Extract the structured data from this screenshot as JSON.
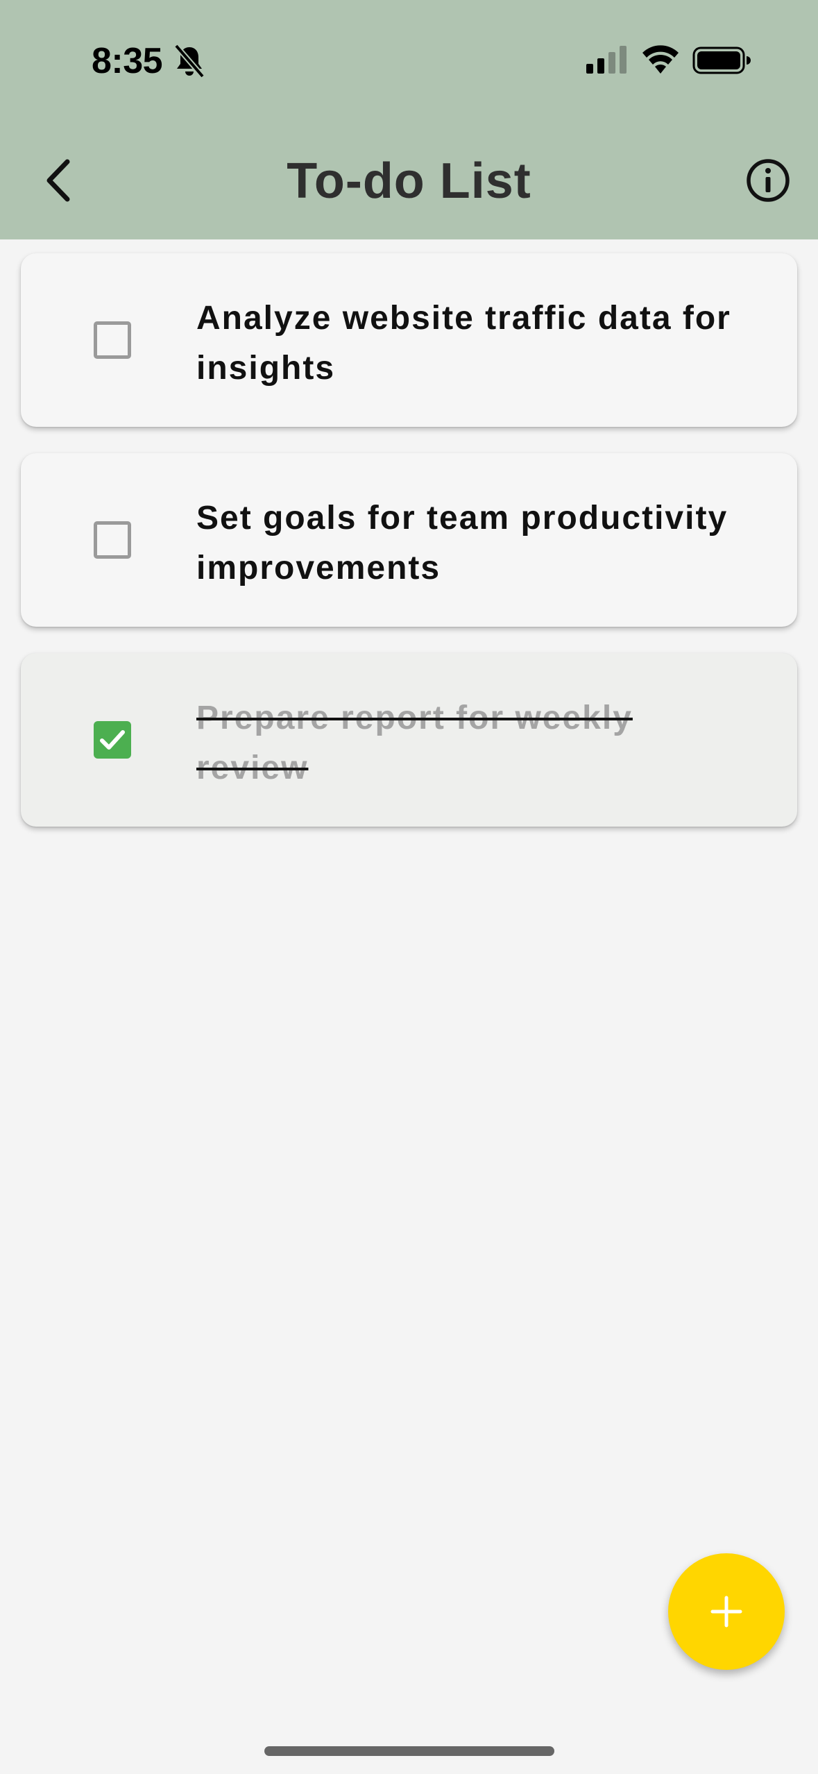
{
  "status_bar": {
    "time": "8:35",
    "icons": [
      "bell-slash-icon",
      "signal-icon",
      "wifi-icon",
      "battery-icon"
    ]
  },
  "header": {
    "title": "To-do List",
    "back_icon": "chevron-left-icon",
    "info_icon": "info-circle-icon",
    "background_color": "#b0c4b1"
  },
  "tasks": [
    {
      "text": "Analyze website traffic data for insights",
      "completed": false
    },
    {
      "text": "Set goals for team productivity improvements",
      "completed": false
    },
    {
      "text": "Prepare report for weekly review",
      "completed": true
    }
  ],
  "fab": {
    "icon": "plus-icon",
    "color": "#ffd600"
  },
  "colors": {
    "checkbox_checked": "#4caf50",
    "page_background": "#f4f4f4"
  }
}
